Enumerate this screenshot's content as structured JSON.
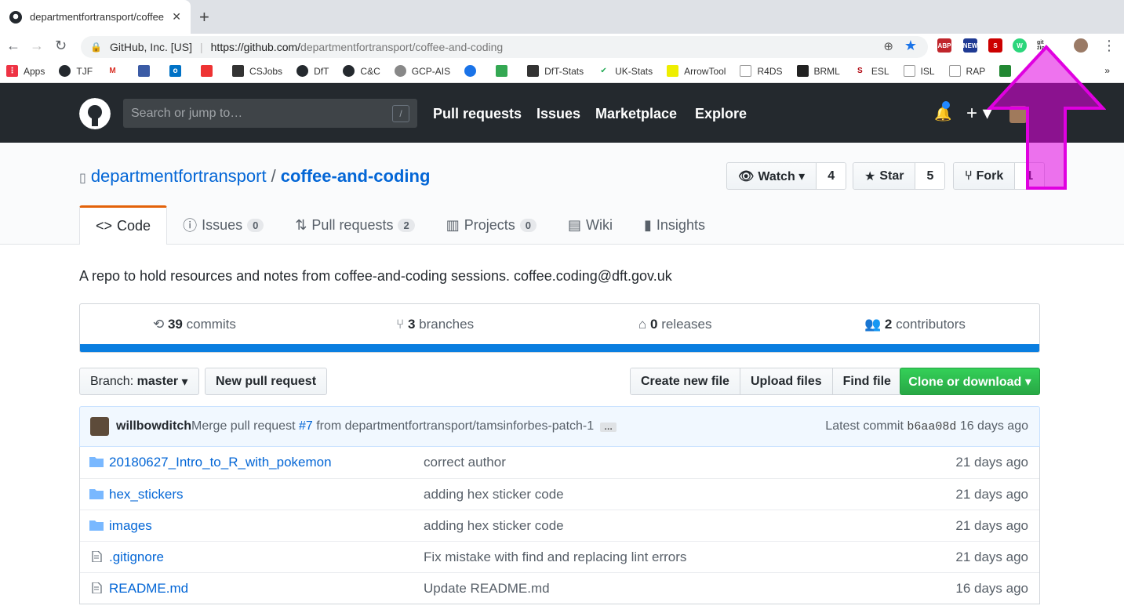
{
  "browser": {
    "tab_title": "departmentfortransport/coffee",
    "url_org": "GitHub, Inc. [US]",
    "url_host": "https://github.com/",
    "url_path": "departmentfortransport/coffee-and-coding",
    "extensions": [
      "ABP",
      "NEW",
      "S",
      "W",
      "git zip"
    ]
  },
  "bookmarks": [
    "Apps",
    "TJF",
    "",
    "",
    "",
    "",
    "CSJobs",
    "DfT",
    "C&C",
    "GCP-AIS",
    "",
    "",
    "DfT-Stats",
    "UK-Stats",
    "ArrowTool",
    "R4DS",
    "BRML",
    "ESL",
    "ISL",
    "RAP",
    ""
  ],
  "bookmarks_more": "»",
  "header": {
    "search_placeholder": "Search or jump to…",
    "search_key": "/",
    "nav": [
      "Pull requests",
      "Issues",
      "Marketplace",
      "Explore"
    ],
    "plus": "+ ▾"
  },
  "repo": {
    "owner": "departmentfortransport",
    "sep": "/",
    "name": "coffee-and-coding",
    "watch_label": "Watch ▾",
    "watch_count": "4",
    "star_label": "Star",
    "star_count": "5",
    "fork_label": "Fork",
    "fork_count": "1"
  },
  "tabs": {
    "code": "Code",
    "issues": "Issues",
    "issues_count": "0",
    "pulls": "Pull requests",
    "pulls_count": "2",
    "projects": "Projects",
    "projects_count": "0",
    "wiki": "Wiki",
    "insights": "Insights"
  },
  "description": "A repo to hold resources and notes from coffee-and-coding sessions. coffee.coding@dft.gov.uk",
  "summary": {
    "commits_n": "39",
    "commits_label": "commits",
    "branches_n": "3",
    "branches_label": "branches",
    "releases_n": "0",
    "releases_label": "releases",
    "contributors_n": "2",
    "contributors_label": "contributors"
  },
  "controls": {
    "branch_prefix": "Branch:",
    "branch": "master",
    "new_pr": "New pull request",
    "create_file": "Create new file",
    "upload": "Upload files",
    "find": "Find file",
    "clone": "Clone or download ▾"
  },
  "commit": {
    "author": "willbowditch",
    "msg_pre": "Merge pull request",
    "pr": "#7",
    "msg_post": "from departmentfortransport/tamsinforbes-patch-1",
    "ellipsis": "…",
    "latest": "Latest commit",
    "sha": "b6aa08d",
    "age": "16 days ago"
  },
  "files": [
    {
      "name": "20180627_Intro_to_R_with_pokemon",
      "type": "dir",
      "message": "correct author",
      "age": "21 days ago"
    },
    {
      "name": "hex_stickers",
      "type": "dir",
      "message": "adding hex sticker code",
      "age": "21 days ago"
    },
    {
      "name": "images",
      "type": "dir",
      "message": "adding hex sticker code",
      "age": "21 days ago"
    },
    {
      "name": ".gitignore",
      "type": "file",
      "message": "Fix mistake with find and replacing lint errors",
      "age": "21 days ago"
    },
    {
      "name": "README.md",
      "type": "file",
      "message": "Update README.md",
      "age": "16 days ago"
    }
  ],
  "colors": {
    "accent": "#0366d6",
    "header": "#24292e",
    "clone": "#28a745",
    "arrow": "#e000e0"
  }
}
